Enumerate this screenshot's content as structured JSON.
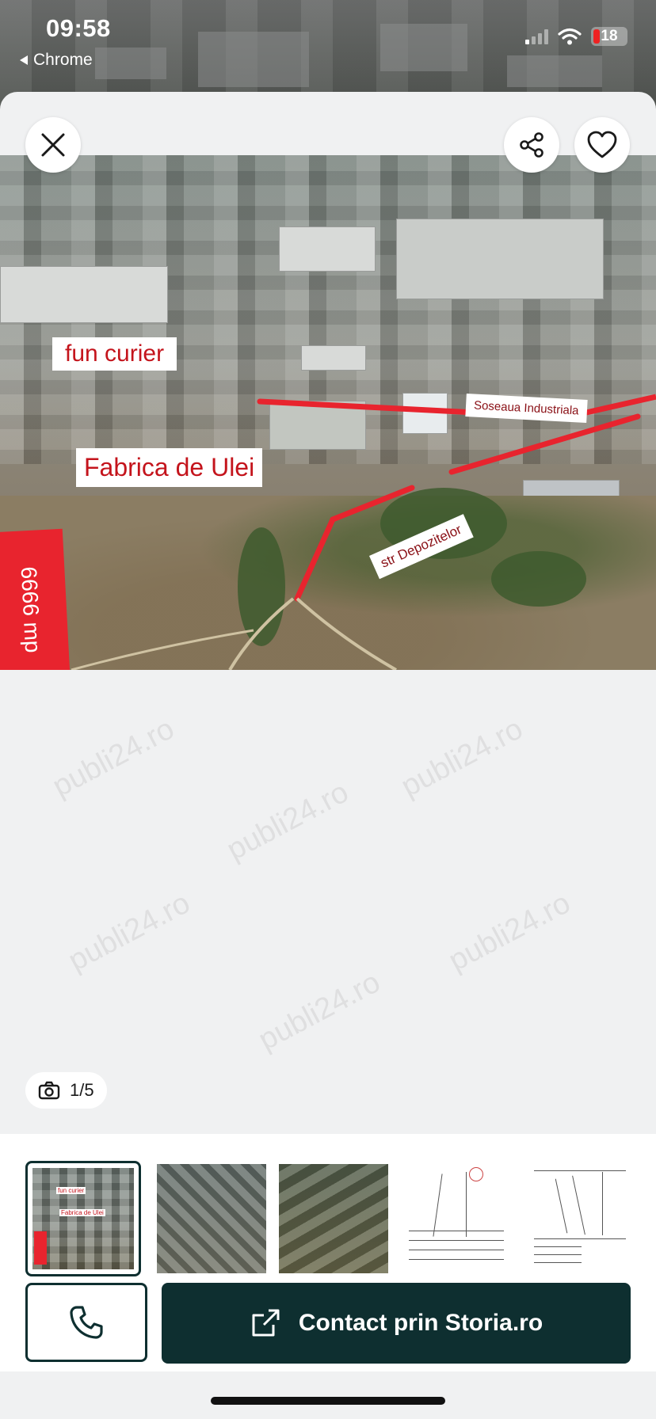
{
  "status_bar": {
    "time": "09:58",
    "back_app": "Chrome",
    "battery": "18"
  },
  "photo": {
    "labels": {
      "fun_curier": "fun curier",
      "fabrica": "Fabrica de Ulei",
      "soseaua": "Soseaua Industriala",
      "depozitelor": "str Depozitelor",
      "area": "6666 mp"
    },
    "watermark": "publi24.ro"
  },
  "gallery": {
    "counter": "1/5",
    "selected_index": 1,
    "total": 5
  },
  "actions": {
    "contact_label": "Contact prin Storia.ro"
  },
  "icons": {
    "close": "close-icon",
    "share": "share-icon",
    "favorite": "heart-icon",
    "camera": "camera-icon",
    "phone": "phone-icon",
    "external": "external-link-icon"
  },
  "colors": {
    "primary": "#0e2f30",
    "label_red": "#c4141c",
    "badge_red": "#e8242e",
    "battery_low": "#e22"
  }
}
